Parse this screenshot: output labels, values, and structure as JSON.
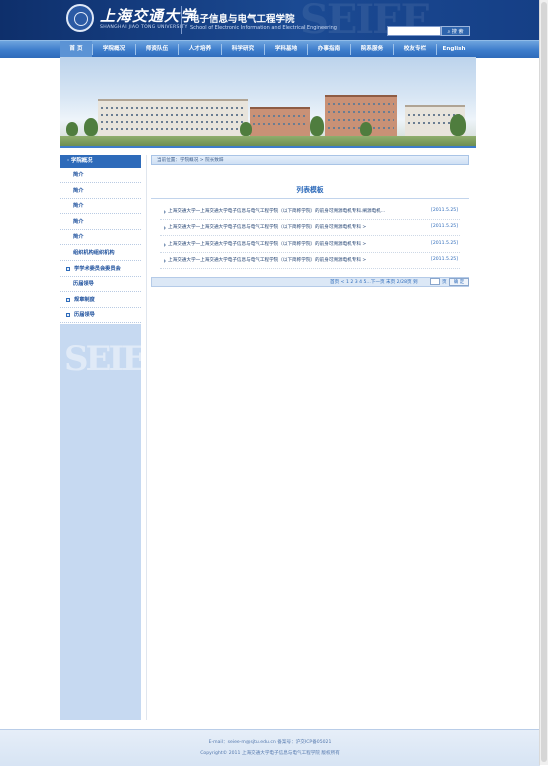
{
  "header": {
    "university_cn": "上海交通大学",
    "university_en": "SHANGHAI JIAO TONG UNIVERSITY",
    "school_cn": "电子信息与电气工程学院",
    "school_en": "School of Electronic Information and Electrical Engineering",
    "search_button": "搜 索",
    "search_value": ""
  },
  "nav": [
    {
      "label": "首 页"
    },
    {
      "label": "学院概况"
    },
    {
      "label": "师资队伍"
    },
    {
      "label": "人才培养"
    },
    {
      "label": "科学研究"
    },
    {
      "label": "学科基地"
    },
    {
      "label": "办事指南"
    },
    {
      "label": "院系服务"
    },
    {
      "label": "校友专栏"
    },
    {
      "label": "English"
    }
  ],
  "sidebar": {
    "title": "· 学院概况",
    "items": [
      {
        "label": "简介"
      },
      {
        "label": "简介"
      },
      {
        "label": "简介"
      },
      {
        "label": "简介"
      },
      {
        "label": "简介"
      },
      {
        "label": "组织机构组织机构"
      },
      {
        "label": "学学术委员会委员会"
      },
      {
        "label": "历届领导"
      },
      {
        "label": "规章制度"
      },
      {
        "label": "历届领导"
      }
    ]
  },
  "breadcrumb": "当前位置：学院概况 > 院长致辞",
  "list": {
    "title": "列表模板",
    "items": [
      {
        "title": "上海交通大学一上海交通大学电子信息与电气工程学院（以下简称学院）的前身可溯源电机专科.阐源电机...",
        "date": "[2011.5.25]"
      },
      {
        "title": "上海交通大学一上海交通大学电子信息与电气工程学院（以下简称学院）的前身可溯源电机专科 >",
        "date": "[2011.5.25]"
      },
      {
        "title": "上海交通大学一上海交通大学电子信息与电气工程学院（以下简称学院）的前身可溯源电机专科 >",
        "date": "[2011.5.25]"
      },
      {
        "title": "上海交通大学一上海交通大学电子信息与电气工程学院（以下简称学院）的前身可溯源电机专科 >",
        "date": "[2011.5.25]"
      }
    ]
  },
  "pager": {
    "text": "首页 < 1 2 3 4 5...下一页 末页 2/28页 到",
    "page_unit": "页",
    "go_button": "确 定",
    "page_input": ""
  },
  "footer": {
    "line1": "E-mail：seiee-m@sjtu.edu.cn 备案号：沪交ICP备05021",
    "line2": "Copyright© 2011 上海交通大学电子信息与电气工程学院 版权所有"
  },
  "colors": {
    "header_dark": "#0e2f6b",
    "nav_blue": "#3d7ccb",
    "accent": "#2e6bba",
    "sidebar_bg": "#c6d9f1"
  }
}
